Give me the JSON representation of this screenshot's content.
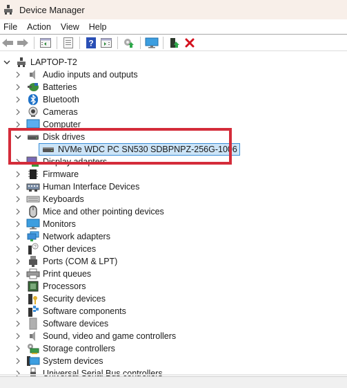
{
  "window": {
    "title": "Device Manager",
    "app_icon": "device-manager-icon"
  },
  "menu": [
    "File",
    "Action",
    "View",
    "Help"
  ],
  "toolbar": {
    "buttons": [
      {
        "name": "back-arrow",
        "icon": "back-arrow-icon"
      },
      {
        "name": "forward-arrow",
        "icon": "forward-arrow-icon"
      },
      {
        "name": "show-hide-console-tree",
        "icon": "console-tree-icon"
      },
      {
        "name": "properties",
        "icon": "properties-icon"
      },
      {
        "name": "help",
        "icon": "help-icon"
      },
      {
        "name": "show-action-pane",
        "icon": "action-pane-icon"
      },
      {
        "name": "update-driver",
        "icon": "update-driver-icon"
      },
      {
        "name": "scan-hardware-changes",
        "icon": "monitor-scan-icon"
      },
      {
        "name": "enable-device",
        "icon": "enable-device-icon"
      },
      {
        "name": "uninstall-device",
        "icon": "uninstall-x-icon"
      }
    ]
  },
  "tree": {
    "root": {
      "label": "LAPTOP-T2",
      "expanded": true,
      "icon": "computer-root-icon"
    },
    "categories": [
      {
        "label": "Audio inputs and outputs",
        "icon": "speaker-icon",
        "expanded": false
      },
      {
        "label": "Batteries",
        "icon": "battery-icon",
        "expanded": false
      },
      {
        "label": "Bluetooth",
        "icon": "bluetooth-icon",
        "expanded": false
      },
      {
        "label": "Cameras",
        "icon": "camera-icon",
        "expanded": false
      },
      {
        "label": "Computer",
        "icon": "computer-icon",
        "expanded": false
      },
      {
        "label": "Disk drives",
        "icon": "disk-drive-icon",
        "expanded": true,
        "children": [
          {
            "label": "NVMe WDC PC SN530 SDBPNPZ-256G-1006",
            "icon": "disk-drive-icon",
            "selected": true
          }
        ]
      },
      {
        "label": "Display adapters",
        "icon": "display-adapter-icon",
        "expanded": false
      },
      {
        "label": "Firmware",
        "icon": "firmware-chip-icon",
        "expanded": false
      },
      {
        "label": "Human Interface Devices",
        "icon": "hid-icon",
        "expanded": false
      },
      {
        "label": "Keyboards",
        "icon": "keyboard-icon",
        "expanded": false
      },
      {
        "label": "Mice and other pointing devices",
        "icon": "mouse-icon",
        "expanded": false
      },
      {
        "label": "Monitors",
        "icon": "monitor-icon",
        "expanded": false
      },
      {
        "label": "Network adapters",
        "icon": "network-adapter-icon",
        "expanded": false
      },
      {
        "label": "Other devices",
        "icon": "unknown-device-icon",
        "expanded": false
      },
      {
        "label": "Ports (COM & LPT)",
        "icon": "port-icon",
        "expanded": false
      },
      {
        "label": "Print queues",
        "icon": "printer-icon",
        "expanded": false
      },
      {
        "label": "Processors",
        "icon": "processor-icon",
        "expanded": false
      },
      {
        "label": "Security devices",
        "icon": "security-device-icon",
        "expanded": false
      },
      {
        "label": "Software components",
        "icon": "software-component-icon",
        "expanded": false
      },
      {
        "label": "Software devices",
        "icon": "software-device-icon",
        "expanded": false
      },
      {
        "label": "Sound, video and game controllers",
        "icon": "speaker-icon",
        "expanded": false
      },
      {
        "label": "Storage controllers",
        "icon": "storage-controller-icon",
        "expanded": false
      },
      {
        "label": "System devices",
        "icon": "system-device-icon",
        "expanded": false
      },
      {
        "label": "Universal Serial Bus controllers",
        "icon": "usb-icon",
        "expanded": false
      }
    ]
  },
  "annotation": {
    "type": "highlight-box",
    "color": "#d42c3a",
    "target": "Disk drives"
  },
  "colors": {
    "titlebar_bg": "#f8efe9",
    "selection_bg": "#cce4f7",
    "selection_border": "#3a8ed8",
    "highlight": "#d42c3a"
  }
}
